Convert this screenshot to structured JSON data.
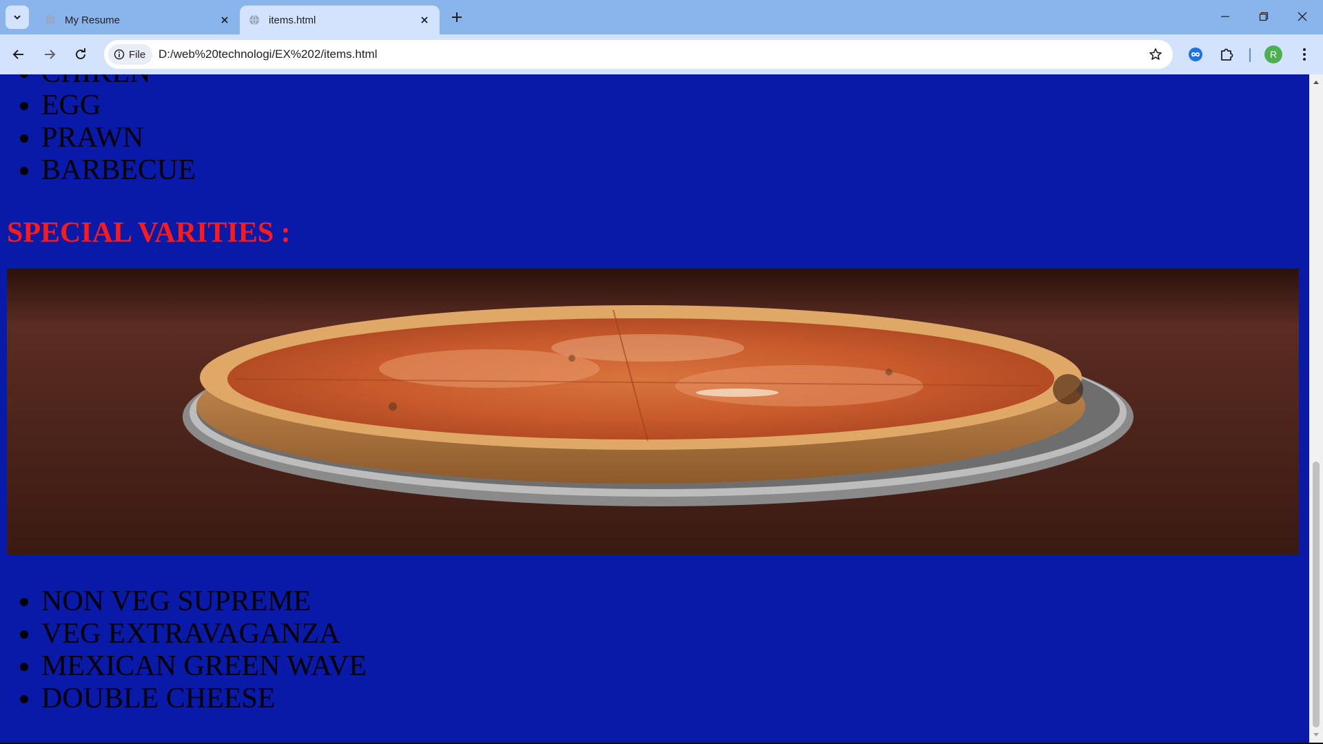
{
  "browser": {
    "tabs": [
      {
        "title": "My Resume",
        "active": false
      },
      {
        "title": "items.html",
        "active": true
      }
    ],
    "url": "D:/web%20technologi/EX%202/items.html",
    "site_chip_label": "File",
    "profile_initial": "R",
    "icons": {
      "tab_search": "chevron-down-icon",
      "back": "arrow-left-icon",
      "forward": "arrow-right-icon",
      "reload": "reload-icon",
      "info": "info-icon",
      "bookmark": "star-icon",
      "extension_1": "infinity-icon",
      "extensions": "puzzle-icon",
      "menu": "kebab-menu-icon"
    }
  },
  "page": {
    "top_list": [
      "CHIKEN",
      "EGG",
      "PRAWN",
      "BARBECUE"
    ],
    "heading": "SPECIAL VARITIES :",
    "image": "pizza-image",
    "bottom_list": [
      "NON VEG SUPREME",
      "VEG EXTRAVAGANZA",
      "MEXICAN GREEN WAVE",
      "DOUBLE CHEESE"
    ],
    "colors": {
      "background": "#0a1aa8",
      "heading": "#ff1a1a",
      "text": "#000000"
    }
  }
}
